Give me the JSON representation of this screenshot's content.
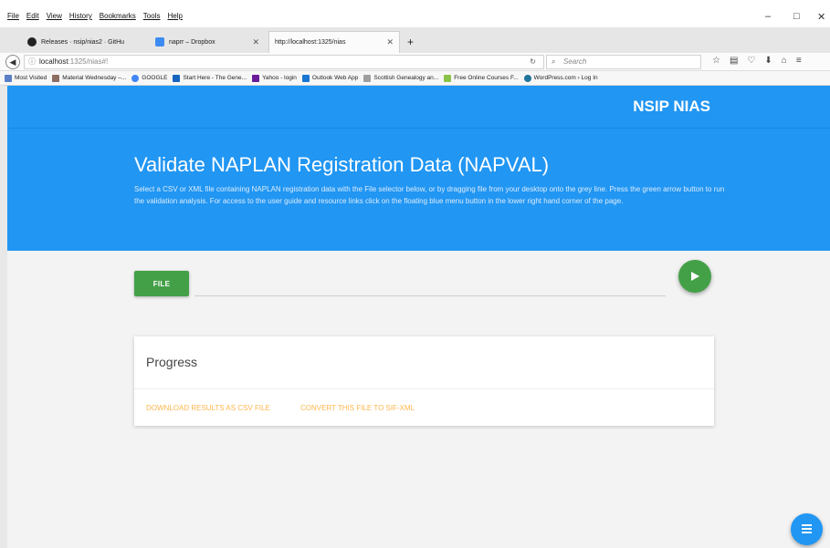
{
  "menubar": {
    "items": [
      "File",
      "Edit",
      "View",
      "History",
      "Bookmarks",
      "Tools",
      "Help"
    ]
  },
  "window": {
    "minimize": "–",
    "maximize": "□",
    "close": "✕"
  },
  "tabs": [
    {
      "label": "Releases · nsip/nias2 · GitHu",
      "icon": "github-icon",
      "active": false
    },
    {
      "label": "naprr – Dropbox",
      "icon": "dropbox-icon",
      "active": false
    },
    {
      "label": "http://localhost:1325/nias",
      "icon": "",
      "active": true
    }
  ],
  "new_tab": "+",
  "navbar": {
    "url_host": "localhost",
    "url_path": ":1325/nias#!",
    "search_placeholder": "Search"
  },
  "bookmarks": [
    {
      "label": "Most Visited",
      "color": "#5b7fc7"
    },
    {
      "label": "Material Wednesday –...",
      "color": "#8d6e63"
    },
    {
      "label": "GOOGLE",
      "color": "#4285f4"
    },
    {
      "label": "Start Here - The Gene...",
      "color": "#1565c0"
    },
    {
      "label": "Yahoo - login",
      "color": "#6a1b9a"
    },
    {
      "label": "Outlook Web App",
      "color": "#1976d2"
    },
    {
      "label": "Scottish Genealogy an...",
      "color": "#9e9e9e"
    },
    {
      "label": "Free Online Courses F...",
      "color": "#8bc34a"
    },
    {
      "label": "WordPress.com › Log In",
      "color": "#21759b"
    }
  ],
  "app": {
    "brand": "NSIP NIAS",
    "title": "Validate NAPLAN Registration Data (NAPVAL)",
    "description": "Select a CSV or XML file containing NAPLAN registration data with the File selector below, or by dragging file from your desktop onto the grey line. Press the green arrow button to run the validation analysis. For access to the user guide and resource links click on the floating blue menu button in the lower right hand corner of the page.",
    "file_button": "FILE",
    "progress_title": "Progress",
    "action_download": "DOWNLOAD RESULTS AS CSV FILE",
    "action_convert": "CONVERT THIS FILE TO SIF-XML"
  },
  "colors": {
    "primary": "#2196f3",
    "success": "#43a047",
    "accent": "#ffb74d"
  }
}
